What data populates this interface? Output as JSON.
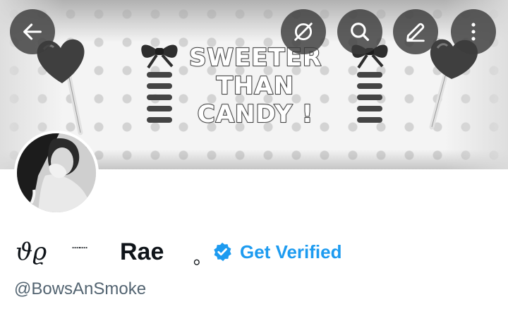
{
  "banner": {
    "title_lines": [
      "SWEETER",
      "THAN",
      "CANDY !"
    ]
  },
  "topbar": {
    "back_icon": "arrow-left-icon",
    "actions": [
      {
        "icon": "grok-icon"
      },
      {
        "icon": "search-icon"
      },
      {
        "icon": "edit-icon"
      },
      {
        "icon": "more-vertical-icon"
      }
    ]
  },
  "profile": {
    "name_deco": "ϑϱ",
    "name_dots": "┈┈",
    "name_main": "Rae",
    "name_suffix": "｡",
    "get_verified_label": "Get Verified",
    "handle": "@BowsAnSmoke"
  },
  "colors": {
    "accent": "#1d9bf0",
    "text_primary": "#0f1419",
    "text_secondary": "#536471",
    "button_overlay": "#3c3c3c"
  }
}
